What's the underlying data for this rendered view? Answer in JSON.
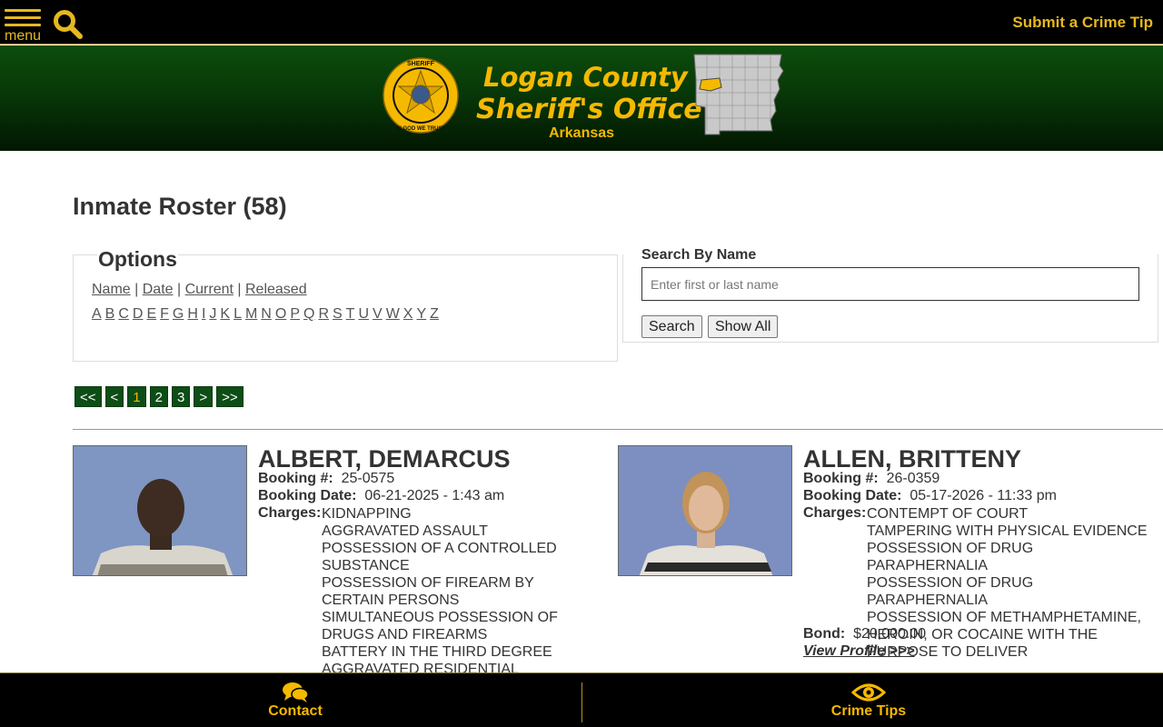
{
  "topbar": {
    "menu_label": "menu",
    "crime_tip_link": "Submit a Crime Tip"
  },
  "banner": {
    "title_line1": "Logan County",
    "title_line2": "Sheriff's Office",
    "state": "Arkansas",
    "badge_top_text": "SHERIFF",
    "badge_bottom_text": "IN GOD WE TRUST"
  },
  "page": {
    "title": "Inmate Roster (58)"
  },
  "options": {
    "title": "Options",
    "sort_links": [
      "Name",
      "Date",
      "Current",
      "Released"
    ],
    "letters": [
      "A",
      "B",
      "C",
      "D",
      "E",
      "F",
      "G",
      "H",
      "I",
      "J",
      "K",
      "L",
      "M",
      "N",
      "O",
      "P",
      "Q",
      "R",
      "S",
      "T",
      "U",
      "V",
      "W",
      "X",
      "Y",
      "Z"
    ]
  },
  "search": {
    "label": "Search By Name",
    "placeholder": "Enter first or last name",
    "value": "",
    "search_button": "Search",
    "show_all_button": "Show All"
  },
  "pager": {
    "first": "<<",
    "prev": "<",
    "pages": [
      "1",
      "2",
      "3"
    ],
    "current": "1",
    "next": ">",
    "last": ">>"
  },
  "inmates": [
    {
      "name": "ALBERT, DEMARCUS",
      "booking_label": "Booking #:",
      "booking_number": "25-0575",
      "booking_date_label": "Booking Date:",
      "booking_date": "06-21-2025 - 1:43 am",
      "charges_label": "Charges:",
      "charges": [
        "KIDNAPPING",
        "AGGRAVATED ASSAULT",
        "POSSESSION OF A CONTROLLED SUBSTANCE",
        "POSSESSION OF FIREARM BY CERTAIN PERSONS",
        "SIMULTANEOUS POSSESSION OF DRUGS AND FIREARMS",
        "BATTERY IN THE THIRD DEGREE",
        "AGGRAVATED RESIDENTIAL BURGLARY"
      ]
    },
    {
      "name": "ALLEN, BRITTENY",
      "booking_label": "Booking #:",
      "booking_number": "26-0359",
      "booking_date_label": "Booking Date:",
      "booking_date": "05-17-2026 - 11:33 pm",
      "charges_label": "Charges:",
      "charges": [
        "CONTEMPT OF COURT",
        "TAMPERING WITH PHYSICAL EVIDENCE",
        "POSSESSION OF DRUG PARAPHERNALIA",
        "POSSESSION OF DRUG PARAPHERNALIA",
        "POSSESSION OF METHAMPHETAMINE, HEROIN, OR COCAINE WITH THE PURPOSE TO DELIVER"
      ],
      "bond_label": "Bond:",
      "bond": "$20,000.00",
      "profile_link": "View Profile >>>"
    }
  ],
  "bottombar": {
    "contact": "Contact",
    "crime_tips": "Crime Tips"
  },
  "colors": {
    "gold": "#f5b900",
    "dark_green": "#0d4d16",
    "black": "#000000"
  },
  "icons": {
    "menu": "hamburger-icon",
    "search": "search-icon",
    "contact": "chat-bubbles-icon",
    "crime_tips": "eye-icon"
  }
}
